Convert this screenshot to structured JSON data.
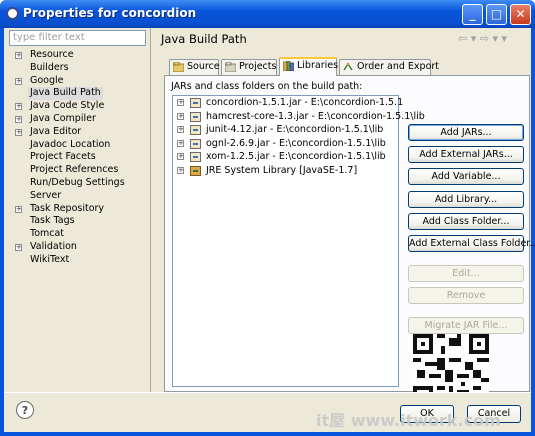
{
  "window": {
    "title": "Properties for concordion",
    "minimize": "_",
    "maximize": "□",
    "close": "✕"
  },
  "filter": {
    "placeholder": "type filter text"
  },
  "tree": [
    {
      "label": "Resource",
      "expandable": true
    },
    {
      "label": "Builders",
      "expandable": false
    },
    {
      "label": "Google",
      "expandable": true
    },
    {
      "label": "Java Build Path",
      "expandable": false,
      "selected": true
    },
    {
      "label": "Java Code Style",
      "expandable": true
    },
    {
      "label": "Java Compiler",
      "expandable": true
    },
    {
      "label": "Java Editor",
      "expandable": true
    },
    {
      "label": "Javadoc Location",
      "expandable": false
    },
    {
      "label": "Project Facets",
      "expandable": false
    },
    {
      "label": "Project References",
      "expandable": false
    },
    {
      "label": "Run/Debug Settings",
      "expandable": false
    },
    {
      "label": "Server",
      "expandable": false
    },
    {
      "label": "Task Repository",
      "expandable": true
    },
    {
      "label": "Task Tags",
      "expandable": false
    },
    {
      "label": "Tomcat",
      "expandable": false
    },
    {
      "label": "Validation",
      "expandable": true
    },
    {
      "label": "WikiText",
      "expandable": false
    }
  ],
  "header": {
    "title": "Java Build Path",
    "nav": "⇦ ▾  ⇨ ▾  ▾"
  },
  "tabs": [
    {
      "label": "Source",
      "active": false
    },
    {
      "label": "Projects",
      "active": false
    },
    {
      "label": "Libraries",
      "active": true
    },
    {
      "label": "Order and Export",
      "active": false
    }
  ],
  "libraries": {
    "label": "JARs and class folders on the build path:",
    "items": [
      {
        "text": "concordion-1.5.1.jar - E:\\concordion-1.5.1",
        "icon": "jar-icon"
      },
      {
        "text": "hamcrest-core-1.3.jar - E:\\concordion-1.5.1\\lib",
        "icon": "jar-icon"
      },
      {
        "text": "junit-4.12.jar - E:\\concordion-1.5.1\\lib",
        "icon": "jar-icon"
      },
      {
        "text": "ognl-2.6.9.jar - E:\\concordion-1.5.1\\lib",
        "icon": "jar-icon"
      },
      {
        "text": "xom-1.2.5.jar - E:\\concordion-1.5.1\\lib",
        "icon": "jar-icon"
      },
      {
        "text": "JRE System Library [JavaSE-1.7]",
        "icon": "library-icon"
      }
    ]
  },
  "buttons": {
    "add_jars": "Add JARs...",
    "add_external_jars": "Add External JARs...",
    "add_variable": "Add Variable...",
    "add_library": "Add Library...",
    "add_class_folder": "Add Class Folder...",
    "add_external_class_folder": "Add External Class Folder...",
    "edit": "Edit...",
    "remove": "Remove",
    "migrate": "Migrate JAR File..."
  },
  "footer": {
    "help": "?",
    "ok": "OK",
    "cancel": "Cancel",
    "watermark": "it屋 www.itwork.com"
  }
}
